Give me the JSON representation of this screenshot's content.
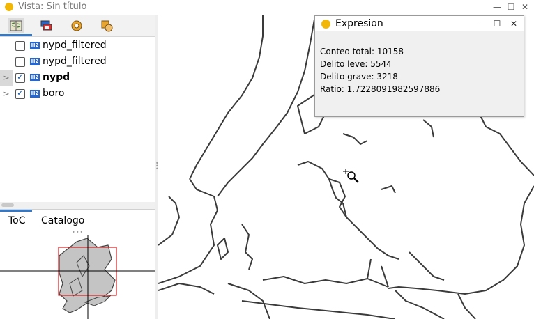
{
  "window": {
    "title": "Vista: Sin título",
    "controls": {
      "minimize": "—",
      "maximize": "☐",
      "close": "✕"
    }
  },
  "toc": {
    "layers": [
      {
        "label": "nypd_filtered",
        "checked": false,
        "bold": false,
        "expandable": false,
        "icon_text": "H2"
      },
      {
        "label": "nypd_filtered",
        "checked": false,
        "bold": false,
        "expandable": false,
        "icon_text": "H2"
      },
      {
        "label": "nypd",
        "checked": true,
        "bold": true,
        "expandable": true,
        "icon_text": "H2"
      },
      {
        "label": "boro",
        "checked": true,
        "bold": false,
        "expandable": true,
        "icon_text": "H2"
      }
    ]
  },
  "tabs": {
    "toc": "ToC",
    "catalog": "Catalogo"
  },
  "dialog": {
    "title": "Expresion",
    "controls": {
      "minimize": "—",
      "maximize": "☐",
      "close": "✕"
    },
    "lines": [
      "Conteo total: 10158",
      "Delito leve: 5544",
      "Delito grave: 3218",
      "Ratio: 1.7228091982597886"
    ]
  },
  "colors": {
    "accent": "#3478c6",
    "layer_icon": "#2a66c7",
    "map_line": "#3a3a3a",
    "extent_box": "#cc2222"
  }
}
